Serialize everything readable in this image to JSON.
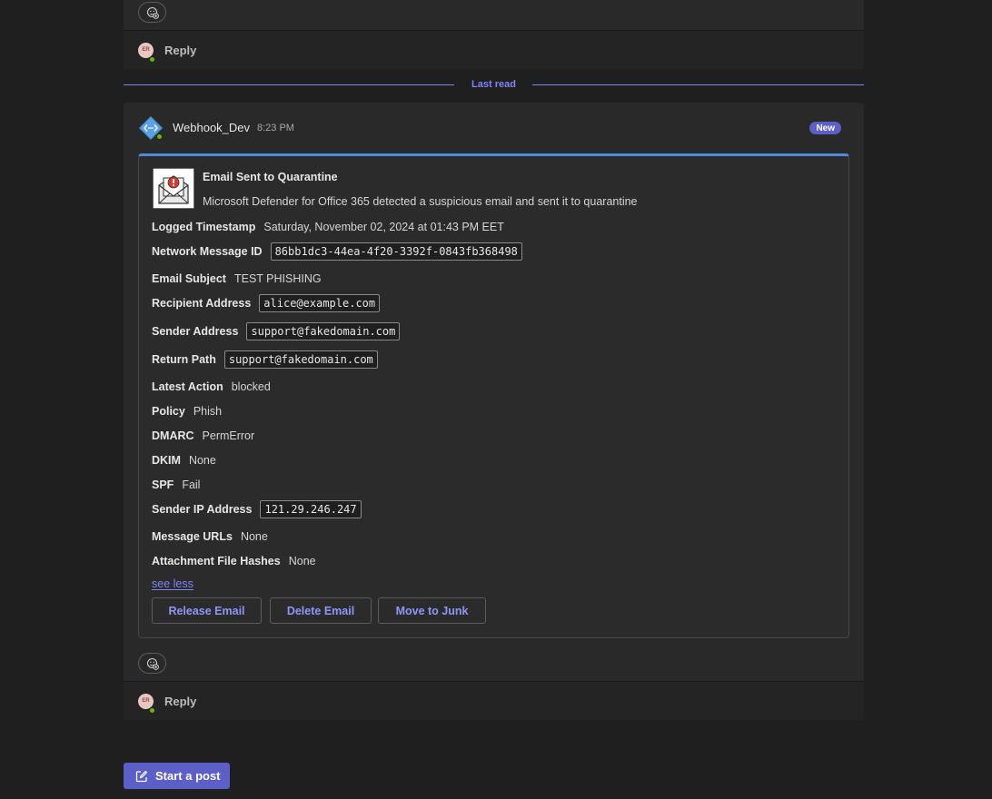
{
  "previous_thread": {
    "reply_label": "Reply",
    "avatar_initials": "ER"
  },
  "divider": {
    "label": "Last read"
  },
  "message": {
    "sender": "Webhook_Dev",
    "time": "8:23 PM",
    "badge": "New",
    "reply_label": "Reply",
    "avatar_initials": "ER"
  },
  "card": {
    "icon": "email-warning-icon",
    "title": "Email Sent to Quarantine",
    "description": "Microsoft Defender for Office 365 detected a suspicious email and sent it to quarantine",
    "facts": [
      {
        "key": "Logged Timestamp",
        "value": "Saturday, November 02, 2024 at 01:43 PM EET"
      },
      {
        "key": "Network Message ID",
        "value": "86bb1dc3-44ea-4f20-3392f-0843fb368498"
      },
      {
        "key": "Email Subject",
        "value": "TEST PHISHING"
      },
      {
        "key": "Recipient Address",
        "value": "alice@example.com"
      },
      {
        "key": "Sender Address",
        "value": "support@fakedomain.com"
      },
      {
        "key": "Return Path",
        "value": "support@fakedomain.com"
      },
      {
        "key": "Latest Action",
        "value": "blocked"
      },
      {
        "key": "Policy",
        "value": "Phish"
      },
      {
        "key": "DMARC",
        "value": "PermError"
      },
      {
        "key": "DKIM",
        "value": "None"
      },
      {
        "key": "SPF",
        "value": "Fail"
      },
      {
        "key": "Sender IP Address",
        "value": "121.29.246.247"
      },
      {
        "key": "Message URLs",
        "value": "None"
      },
      {
        "key": "Attachment File Hashes",
        "value": "None"
      }
    ],
    "see_less": "see less",
    "actions": {
      "release": "Release Email",
      "delete": "Delete Email",
      "junk": "Move to Junk"
    }
  },
  "start_post": "Start a post",
  "colors": {
    "accent": "#5b5fc7",
    "link": "#7f85f5",
    "card_border_top": "#4f8ddc",
    "presence": "#6bb700"
  }
}
